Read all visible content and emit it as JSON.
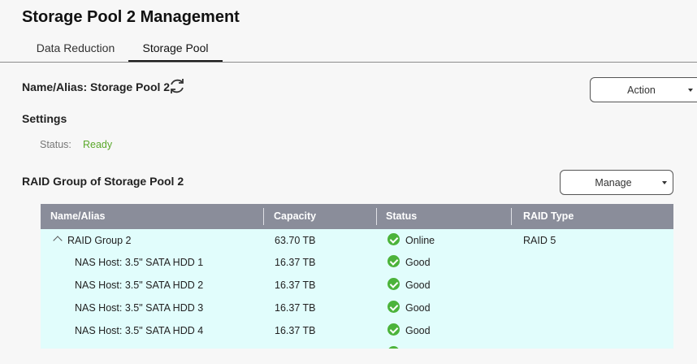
{
  "window": {
    "title": "Storage Pool 2 Management"
  },
  "tabs": [
    {
      "label": "Data Reduction",
      "active": false
    },
    {
      "label": "Storage Pool",
      "active": true
    }
  ],
  "pool": {
    "name_alias": "Name/Alias: Storage Pool 2",
    "action_label": "Action",
    "settings_label": "Settings",
    "status_label": "Status:",
    "status_value": "Ready"
  },
  "raid_section": {
    "heading": "RAID Group of Storage Pool 2",
    "manage_label": "Manage"
  },
  "table": {
    "columns": [
      "Name/Alias",
      "Capacity",
      "Status",
      "RAID Type"
    ],
    "rows": [
      {
        "name": "RAID Group 2",
        "capacity": "63.70 TB",
        "status": "Online",
        "raid_type": "RAID 5"
      },
      {
        "name": "NAS Host: 3.5\" SATA HDD 1",
        "capacity": "16.37 TB",
        "status": "Good",
        "raid_type": ""
      },
      {
        "name": "NAS Host: 3.5\" SATA HDD 2",
        "capacity": "16.37 TB",
        "status": "Good",
        "raid_type": ""
      },
      {
        "name": "NAS Host: 3.5\" SATA HDD 3",
        "capacity": "16.37 TB",
        "status": "Good",
        "raid_type": ""
      },
      {
        "name": "NAS Host: 3.5\" SATA HDD 4",
        "capacity": "16.37 TB",
        "status": "Good",
        "raid_type": ""
      }
    ]
  },
  "colors": {
    "status_ready": "#5aa82a",
    "status_ok_icon": "#4bb33a",
    "table_header_bg": "#8a8d9a",
    "table_body_bg": "#e1fdfc"
  },
  "icons": {
    "refresh": "refresh-icon",
    "status_ok": "check-circle-icon",
    "expand": "chevron-up-icon",
    "dropdown": "caret-down-icon"
  }
}
